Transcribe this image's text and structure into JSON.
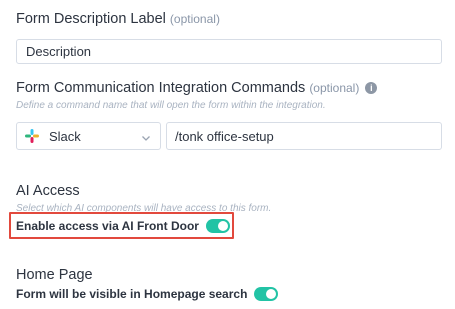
{
  "description_label": {
    "title": "Form Description Label",
    "optional": "(optional)",
    "input_value": "Description"
  },
  "commands": {
    "title": "Form Communication Integration Commands",
    "optional": "(optional)",
    "info_icon": "info-icon",
    "hint": "Define a command name that will open the form within the integration.",
    "integration_select": "Slack",
    "command_value": "/tonk office-setup"
  },
  "ai_access": {
    "title": "AI Access",
    "hint": "Select which AI components will have access to this form.",
    "toggle_label": "Enable access via AI Front Door",
    "toggle_on": true
  },
  "home_page": {
    "title": "Home Page",
    "toggle_label": "Form will be visible in Homepage search",
    "toggle_on": true
  },
  "colors": {
    "toggle_on": "#22c3a5",
    "highlight_border": "#e2493d",
    "hint_text": "#a9b3c1"
  }
}
